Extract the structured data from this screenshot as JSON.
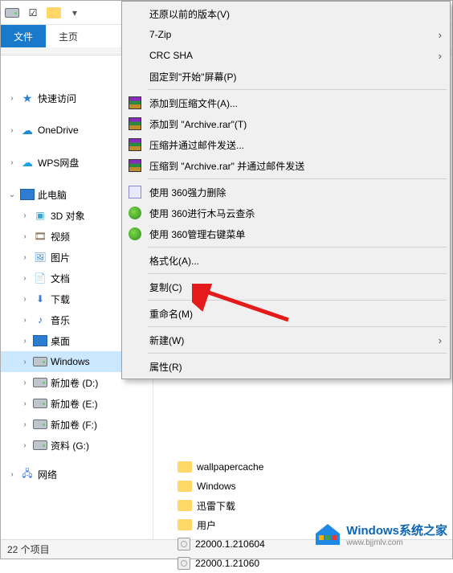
{
  "tabs": {
    "file": "文件",
    "home": "主页"
  },
  "sidebar": {
    "quick": "快速访问",
    "onedrive": "OneDrive",
    "wps": "WPS网盘",
    "pc": "此电脑",
    "items": [
      {
        "label": "3D 对象"
      },
      {
        "label": "视频"
      },
      {
        "label": "图片"
      },
      {
        "label": "文档"
      },
      {
        "label": "下载"
      },
      {
        "label": "音乐"
      },
      {
        "label": "桌面"
      },
      {
        "label": "Windows"
      },
      {
        "label": "新加卷 (D:)"
      },
      {
        "label": "新加卷 (E:)"
      },
      {
        "label": "新加卷 (F:)"
      },
      {
        "label": "资料 (G:)"
      }
    ],
    "network": "网络"
  },
  "content": {
    "rows": [
      {
        "type": "folder",
        "name": "wallpapercache"
      },
      {
        "type": "folder",
        "name": "Windows"
      },
      {
        "type": "folder",
        "name": "迅雷下载"
      },
      {
        "type": "folder",
        "name": "用户"
      },
      {
        "type": "iso",
        "name": "22000.1.210604"
      },
      {
        "type": "iso",
        "name": "22000.1.21060"
      }
    ]
  },
  "ctx": {
    "restore": "还原以前的版本(V)",
    "sevenzip": "7-Zip",
    "crc": "CRC SHA",
    "pin": "固定到\"开始\"屏幕(P)",
    "rar": [
      "添加到压缩文件(A)...",
      "添加到 \"Archive.rar\"(T)",
      "压缩并通过邮件发送...",
      "压缩到 \"Archive.rar\" 并通过邮件发送"
    ],
    "q360": [
      "使用 360强力删除",
      "使用 360进行木马云查杀",
      "使用 360管理右键菜单"
    ],
    "format": "格式化(A)...",
    "copy": "复制(C)",
    "rename": "重命名(M)",
    "new": "新建(W)",
    "prop": "属性(R)"
  },
  "status": {
    "count": "22 个项目"
  },
  "watermark": {
    "title": "Windows系统之家",
    "url": "www.bjjmlv.com"
  }
}
